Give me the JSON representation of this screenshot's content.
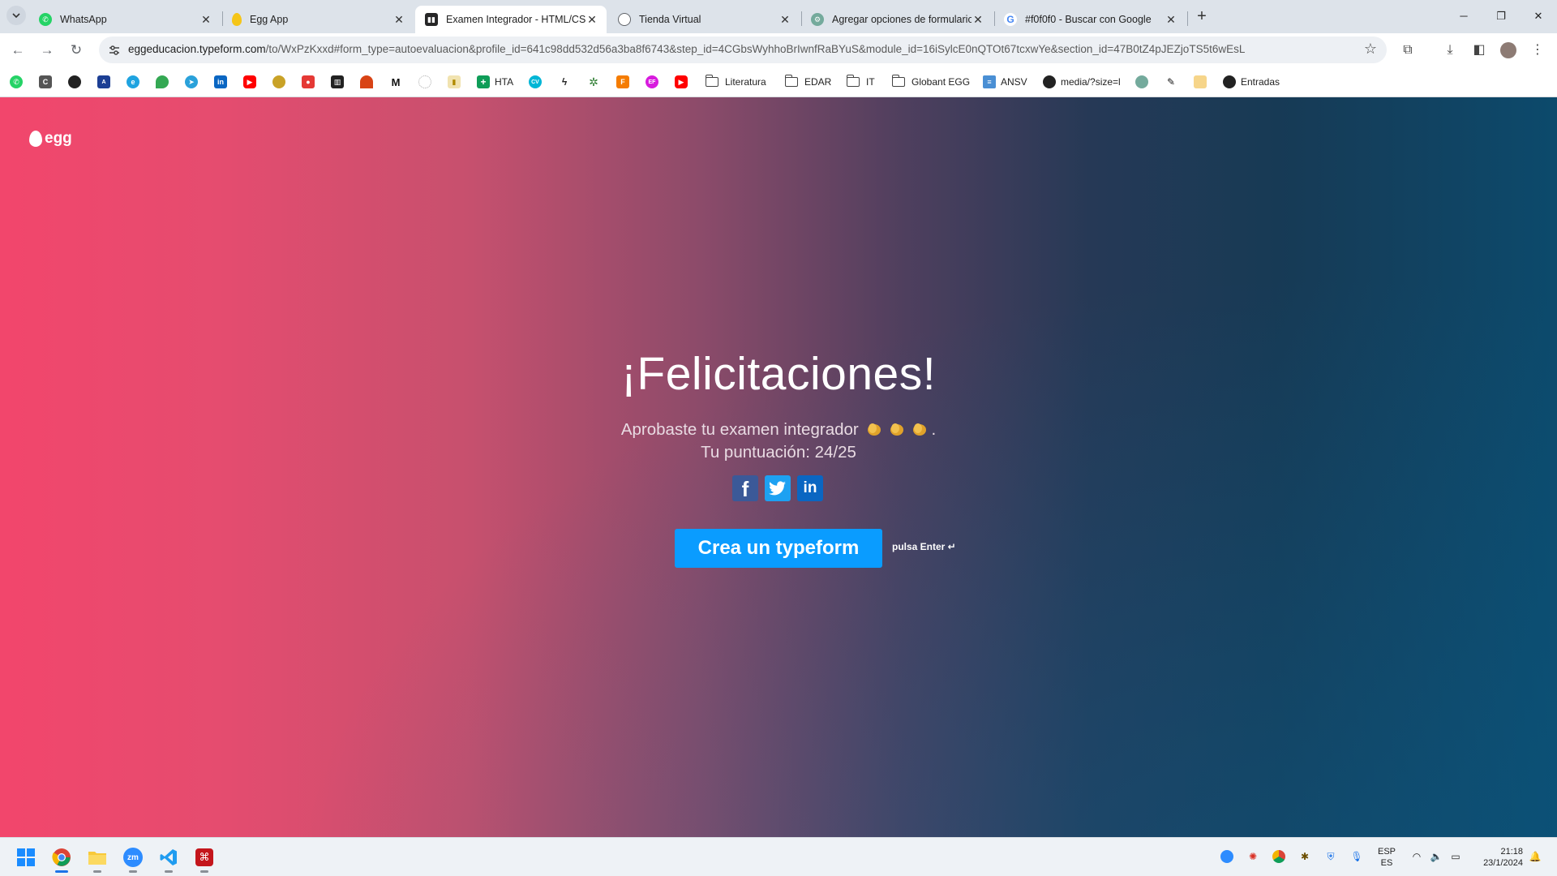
{
  "browser": {
    "tabs": [
      {
        "title": "WhatsApp",
        "icon": "whatsapp-icon",
        "color": "#25d366",
        "active": false
      },
      {
        "title": "Egg App",
        "icon": "egg-icon",
        "color": "#f5c518",
        "active": false
      },
      {
        "title": "Examen Integrador - HTML/CSS",
        "icon": "typeform-icon",
        "color": "#262627",
        "active": true
      },
      {
        "title": "Tienda Virtual",
        "icon": "globe-icon",
        "color": "#5f6368",
        "active": false
      },
      {
        "title": "Agregar opciones de formulario",
        "icon": "chatgpt-icon",
        "color": "#74aa9c",
        "active": false
      },
      {
        "title": "#f0f0f0 - Buscar con Google",
        "icon": "google-icon",
        "color": "#4285f4",
        "active": false
      }
    ],
    "url_host": "eggeducacion.typeform.com",
    "url_path": "/to/WxPzKxxd#form_type=autoevaluacion&profile_id=641c98dd532d56a3ba8f6743&step_id=4CGbsWyhhoBrIwnfRaBYuS&module_id=16iSylcE0nQTOt67tcxwYe&section_id=47B0tZ4pJEZjoTS5t6wEsL"
  },
  "bookmarks": {
    "labeled": [
      "HTA",
      "Literatura",
      "EDAR",
      "IT",
      "Globant EGG",
      "ANSV",
      "media/?size=l",
      "Entradas"
    ]
  },
  "page": {
    "logo_text": "egg",
    "heading": "¡Felicitaciones!",
    "message_line1": "Aprobaste tu examen integrador",
    "message_line1_end": ".",
    "message_line2": "Tu puntuación: 24/25",
    "share": {
      "facebook": "f",
      "linkedin": "in"
    },
    "cta_label": "Crea un typeform",
    "hint": "pulsa Enter ↵"
  },
  "taskbar": {
    "language_line1": "ESP",
    "language_line2": "ES",
    "time": "21:18",
    "date": "23/1/2024"
  },
  "colors": {
    "cta": "#0a9cff",
    "gradient_left": "#f2466c",
    "gradient_right": "#0c4a6c"
  }
}
